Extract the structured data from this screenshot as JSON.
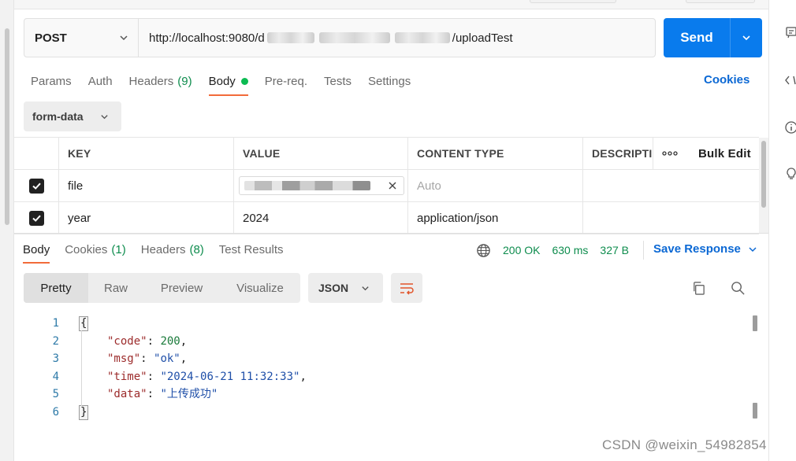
{
  "request": {
    "method": "POST",
    "url_start": "http://localhost:9080/d",
    "url_end": "/uploadTest",
    "send_label": "Send"
  },
  "request_tabs": [
    {
      "label": "Params",
      "count": ""
    },
    {
      "label": "Auth",
      "count": ""
    },
    {
      "label": "Headers",
      "count": "(9)"
    },
    {
      "label": "Body",
      "count": ""
    },
    {
      "label": "Pre-req.",
      "count": ""
    },
    {
      "label": "Tests",
      "count": ""
    },
    {
      "label": "Settings",
      "count": ""
    }
  ],
  "cookies_label": "Cookies",
  "body_mode": "form-data",
  "params_table": {
    "headers": {
      "key": "KEY",
      "value": "VALUE",
      "content_type": "CONTENT TYPE",
      "description": "DESCRIPTI",
      "more": "ooo",
      "bulk_edit": "Bulk Edit"
    },
    "rows": [
      {
        "key": "file",
        "value": "",
        "content_type": "Auto",
        "checked": true
      },
      {
        "key": "year",
        "value": "2024",
        "content_type": "application/json",
        "checked": true
      }
    ]
  },
  "response_tabs": [
    {
      "label": "Body",
      "count": ""
    },
    {
      "label": "Cookies",
      "count": "(1)"
    },
    {
      "label": "Headers",
      "count": "(8)"
    },
    {
      "label": "Test Results",
      "count": ""
    }
  ],
  "response_status": {
    "status": "200 OK",
    "time": "630 ms",
    "size": "327 B"
  },
  "save_response_label": "Save Response",
  "view_modes": [
    "Pretty",
    "Raw",
    "Preview",
    "Visualize"
  ],
  "format": "JSON",
  "response_body": {
    "line_numbers": [
      "1",
      "2",
      "3",
      "4",
      "5",
      "6"
    ],
    "open_brace": "{",
    "close_brace": "}",
    "fields": [
      {
        "key": "\"code\"",
        "sep": ": ",
        "value": "200",
        "trail": ","
      },
      {
        "key": "\"msg\"",
        "sep": ": ",
        "value": "\"ok\"",
        "trail": ","
      },
      {
        "key": "\"time\"",
        "sep": ": ",
        "value": "\"2024-06-21 11:32:33\"",
        "trail": ","
      },
      {
        "key": "\"data\"",
        "sep": ": ",
        "value": "\"上传成功\"",
        "trail": ""
      }
    ]
  },
  "watermark": "CSDN @weixin_54982854",
  "colors": {
    "send": "#097bed",
    "active_tab_underline": "#f26b3a",
    "success": "#0d8c4d",
    "link": "#0b68d4"
  }
}
